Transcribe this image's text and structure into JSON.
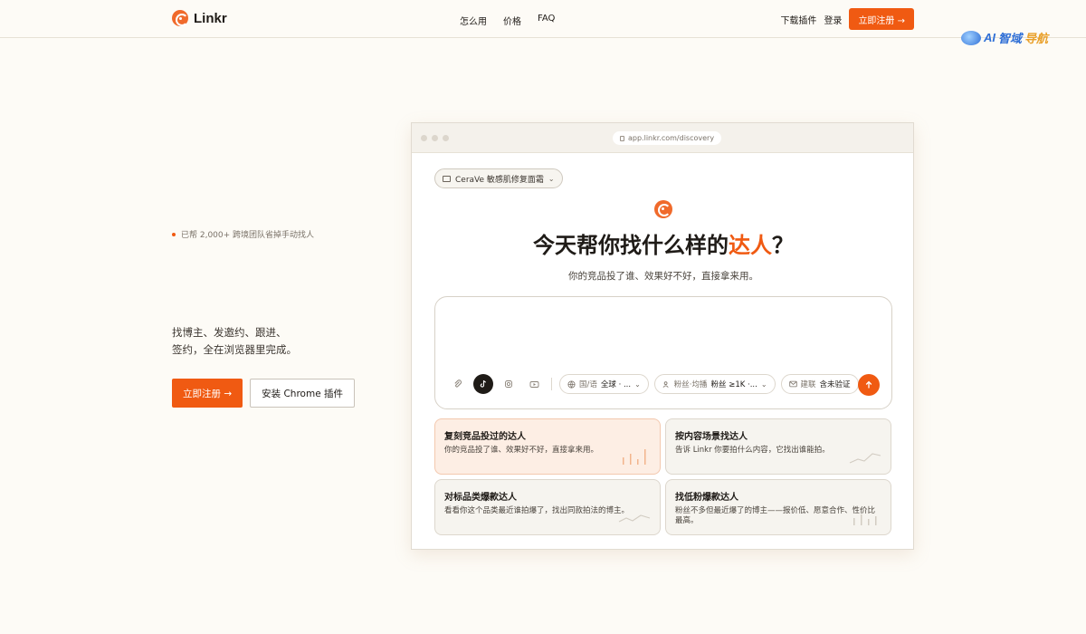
{
  "nav": {
    "brand": "Linkr",
    "links": [
      "怎么用",
      "价格",
      "FAQ"
    ],
    "download": "下载插件",
    "login": "登录",
    "signup": "立即注册 →"
  },
  "watermark": {
    "ai": "AI",
    "cn1": "智域",
    "cn2": "导航"
  },
  "hero": {
    "badge": "已帮 2,000+ 跨境团队省掉手动找人",
    "desc_line1": "找博主、发邀约、跟进、",
    "desc_line2": "签约，全在浏览器里完成。",
    "cta_primary": "立即注册 →",
    "cta_secondary": "安装 Chrome 插件"
  },
  "browser": {
    "url": "app.linkr.com/discovery",
    "project": "CeraVe 敏感肌修复面霜",
    "title_pre": "今天帮你找什么样的",
    "title_accent": "达人",
    "title_post": "？",
    "subtitle": "你的竞品投了谁、效果好不好，直接拿来用。",
    "filters": {
      "region_label": "国/语",
      "region_value": "全球 · ...",
      "followers_label": "粉丝·均播",
      "followers_value": "粉丝 ≥1K ·...",
      "contact_label": "建联",
      "contact_value": "含未验证"
    },
    "cards": [
      {
        "title": "复刻竞品投过的达人",
        "desc": "你的竞品投了谁、效果好不好，直接拿来用。"
      },
      {
        "title": "按内容场景找达人",
        "desc": "告诉 Linkr 你要拍什么内容，它找出谁能拍。"
      },
      {
        "title": "对标品类爆款达人",
        "desc": "看看你这个品类最近谁拍爆了，找出同款拍法的博主。"
      },
      {
        "title": "找低粉爆款达人",
        "desc": "粉丝不多但最近爆了的博主——报价低、愿意合作、性价比最高。"
      }
    ]
  },
  "colors": {
    "accent": "#f05a12",
    "background": "#fdfbf6"
  }
}
